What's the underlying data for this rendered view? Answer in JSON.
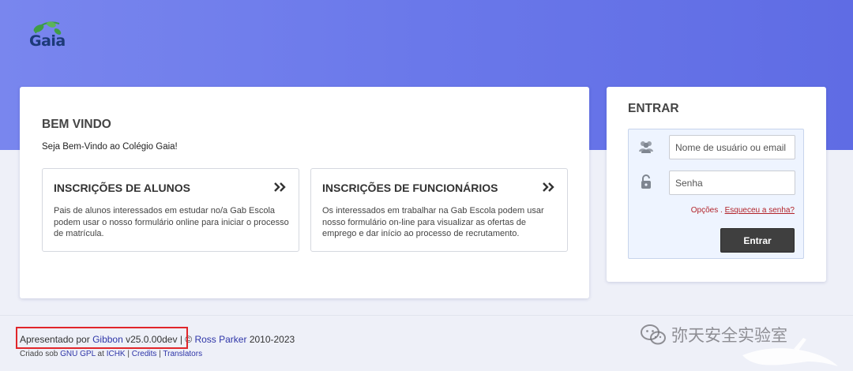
{
  "header": {
    "logo_text": "Gaia",
    "logo_icon": "leaf-icon"
  },
  "welcome": {
    "title": "BEM VINDO",
    "intro": "Seja Bem-Vindo ao Colégio Gaia!",
    "cards": [
      {
        "title": "INSCRIÇÕES DE ALUNOS",
        "icon": "double-chevron-right-icon",
        "description": "Pais de alunos interessados em estudar no/a Gab Escola podem usar o nosso formulário online para iniciar o processo de matrícula."
      },
      {
        "title": "INSCRIÇÕES DE FUNCIONÁRIOS",
        "icon": "double-chevron-right-icon",
        "description": "Os interessados em trabalhar na Gab Escola podem usar nosso formulário on-line para visualizar as ofertas de emprego e dar início ao processo de recrutamento."
      }
    ]
  },
  "login": {
    "title": "ENTRAR",
    "username_placeholder": "Nome de usuário ou email",
    "password_placeholder": "Senha",
    "options_label": "Opções",
    "separator": " . ",
    "forgot_label": "Esqueceu a senha?",
    "submit_label": "Entrar",
    "link_color": "#b2232a"
  },
  "footer": {
    "powered_prefix": "Apresentado por ",
    "gibbon_link": "Gibbon",
    "version": " v25.0.00dev",
    "after_version": " | © ",
    "author_link": "Ross Parker",
    "years": " 2010-2023",
    "created_prefix": "Criado sob ",
    "license_link": "GNU GPL",
    "at_text": " at ",
    "org_link": "ICHK",
    "sep1": " | ",
    "credits_link": "Credits",
    "sep2": " | ",
    "translators_link": "Translators"
  },
  "watermark": {
    "text": "弥天安全实验室"
  },
  "colors": {
    "banner": "#6a78ea",
    "link": "#2e35a8",
    "button": "#3f3f3f",
    "highlight": "#e0262b"
  }
}
